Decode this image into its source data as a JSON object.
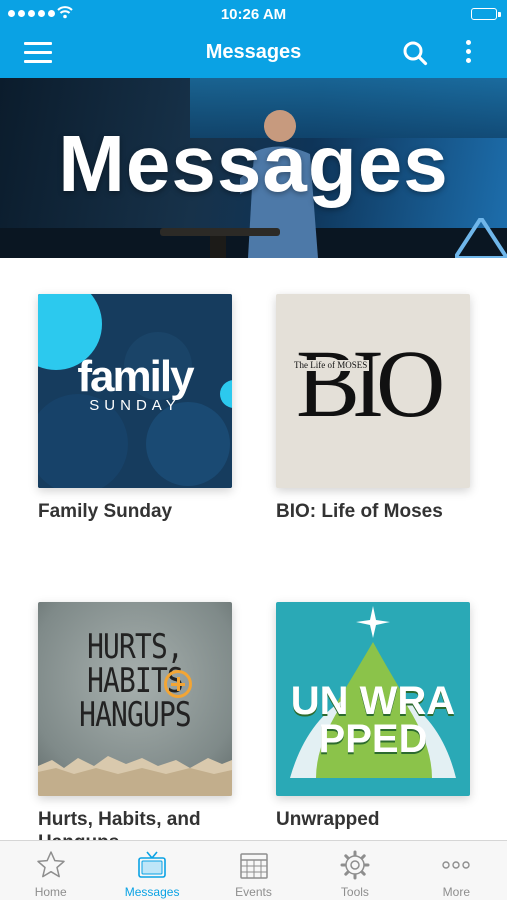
{
  "status_bar": {
    "time": "10:26 AM"
  },
  "nav": {
    "title": "Messages"
  },
  "hero": {
    "title": "Messages"
  },
  "cards": [
    {
      "label": "Family Sunday",
      "art_title": "family",
      "art_subtitle": "SUNDAY"
    },
    {
      "label": "BIO: Life of Moses",
      "art_title": "BIO",
      "art_subtitle": "The Life of MOSES"
    },
    {
      "label": "Hurts, Habits, and Hangups",
      "art_title": "HURTS, HABITS HANGUPS"
    },
    {
      "label": "Unwrapped",
      "art_title": "UN WRA PPED"
    }
  ],
  "tabs": [
    {
      "label": "Home",
      "icon": "star-icon"
    },
    {
      "label": "Messages",
      "icon": "tv-icon",
      "active": true
    },
    {
      "label": "Events",
      "icon": "calendar-icon"
    },
    {
      "label": "Tools",
      "icon": "gear-icon"
    },
    {
      "label": "More",
      "icon": "more-dots-icon"
    }
  ],
  "colors": {
    "accent": "#0aa2e4",
    "tab_inactive": "#8e8e8e",
    "tab_bar_bg": "#f7f7f7"
  }
}
